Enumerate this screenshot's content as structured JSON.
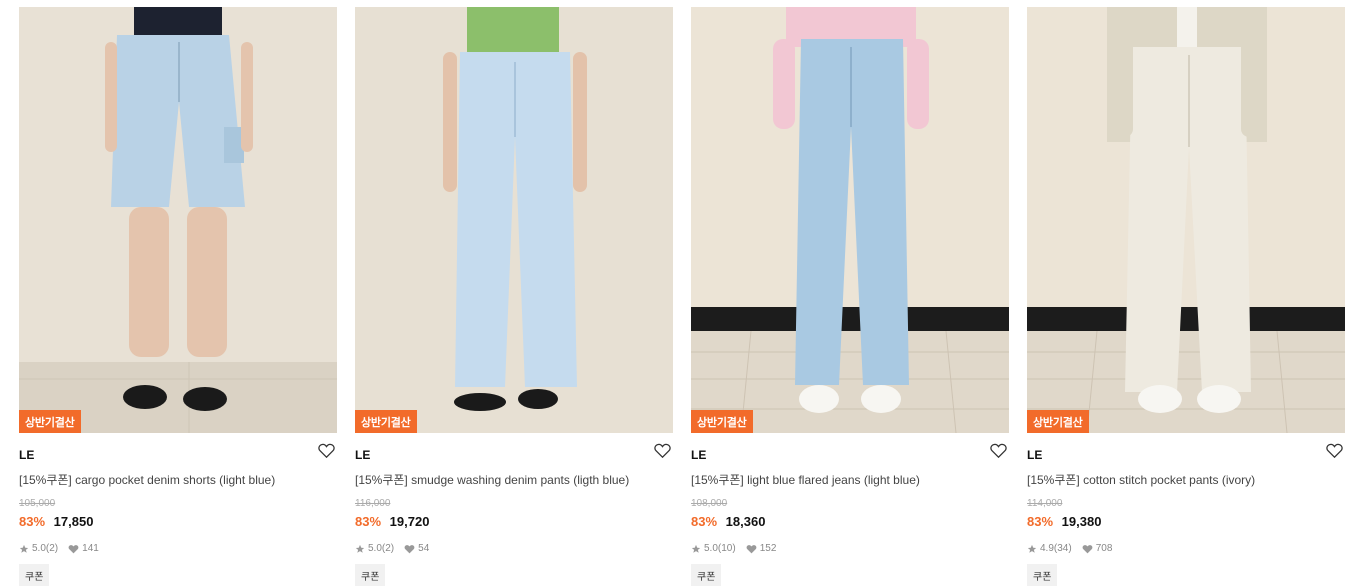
{
  "products": [
    {
      "badge": "상반기결산",
      "brand": "LE",
      "name": "[15%쿠폰] cargo pocket denim shorts (light blue)",
      "original_price": "105,000",
      "discount": "83%",
      "price": "17,850",
      "rating": "5.0",
      "review_count": "(2)",
      "likes": "141",
      "coupon": "쿠폰"
    },
    {
      "badge": "상반기결산",
      "brand": "LE",
      "name": "[15%쿠폰] smudge washing denim pants (ligth blue)",
      "original_price": "116,000",
      "discount": "83%",
      "price": "19,720",
      "rating": "5.0",
      "review_count": "(2)",
      "likes": "54",
      "coupon": "쿠폰"
    },
    {
      "badge": "상반기결산",
      "brand": "LE",
      "name": "[15%쿠폰] light blue flared jeans (light blue)",
      "original_price": "108,000",
      "discount": "83%",
      "price": "18,360",
      "rating": "5.0",
      "review_count": "(10)",
      "likes": "152",
      "coupon": "쿠폰"
    },
    {
      "badge": "상반기결산",
      "brand": "LE",
      "name": "[15%쿠폰] cotton stitch pocket pants (ivory)",
      "original_price": "114,000",
      "discount": "83%",
      "price": "19,380",
      "rating": "4.9",
      "review_count": "(34)",
      "likes": "708",
      "coupon": "쿠폰"
    }
  ],
  "colors": {
    "accent": "#f26b2a",
    "wall": "#e9e2d6",
    "denim_light": "#b9d2e6",
    "ivory": "#eeeae0"
  },
  "icons": [
    "heart-outline-icon",
    "star-icon",
    "heart-filled-icon"
  ]
}
